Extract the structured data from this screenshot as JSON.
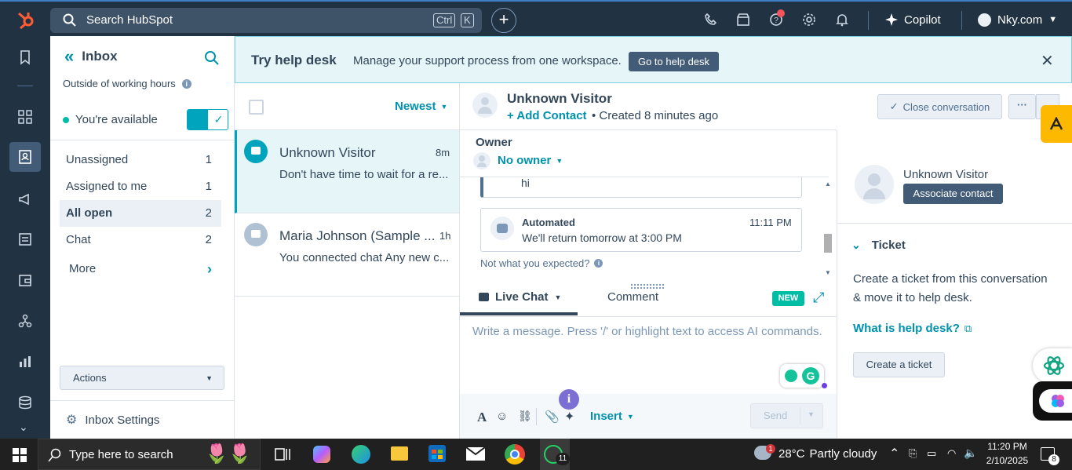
{
  "topbar": {
    "search_placeholder": "Search HubSpot",
    "shortcut_ctrl": "Ctrl",
    "shortcut_k": "K",
    "add_label": "+",
    "copilot_label": "Copilot",
    "account_name": "Nky.com"
  },
  "sidebar": {
    "title": "Inbox",
    "hours_status": "Outside of working hours",
    "availability": "You're available",
    "items": [
      {
        "label": "Unassigned",
        "count": "1"
      },
      {
        "label": "Assigned to me",
        "count": "1"
      },
      {
        "label": "All open",
        "count": "2"
      },
      {
        "label": "Chat",
        "count": "2"
      }
    ],
    "more_label": "More",
    "actions_label": "Actions",
    "settings_label": "Inbox Settings"
  },
  "banner": {
    "title": "Try help desk",
    "text": "Manage your support process from one workspace.",
    "button": "Go to help desk"
  },
  "list": {
    "sort_label": "Newest",
    "conversations": [
      {
        "name": "Unknown Visitor",
        "time": "8m",
        "preview": "Don't have time to wait for a re..."
      },
      {
        "name": "Maria Johnson (Sample ...",
        "time": "1h",
        "preview": "You connected chat Any new c..."
      }
    ]
  },
  "conversation": {
    "visitor_name": "Unknown Visitor",
    "add_contact": "+ Add Contact",
    "created": "Created 8 minutes ago",
    "close_label": "Close conversation",
    "more_label": "···",
    "owner_label": "Owner",
    "owner_value": "No owner",
    "msg_hi": "hi",
    "automated_label": "Automated",
    "automated_time": "11:11 PM",
    "automated_text": "We'll return tomorrow at 3:00 PM",
    "not_expected": "Not what you expected?",
    "tab_live_chat": "Live Chat",
    "tab_comment": "Comment",
    "new_badge": "NEW",
    "composer_placeholder": "Write a message. Press '/' or highlight text to access AI commands.",
    "insert_label": "Insert",
    "send_label": "Send",
    "info_badge": "i"
  },
  "contact_panel": {
    "name": "Unknown Visitor",
    "associate_label": "Associate contact",
    "ticket_title": "Ticket",
    "ticket_text": "Create a ticket from this conversation & move it to help desk.",
    "helpdesk_link": "What is help desk?",
    "create_ticket": "Create a ticket"
  },
  "taskbar": {
    "search_placeholder": "Type here to search",
    "whatsapp_badge": "11",
    "weather_badge": "1",
    "weather_temp": "28°C",
    "weather_text": "Partly cloudy",
    "time": "11:20 PM",
    "date": "2/10/2025",
    "notif_count": "8"
  },
  "colors": {
    "nav_dark": "#213343",
    "accent_teal": "#0091ae",
    "hubspot_orange": "#ff5c35",
    "new_badge_green": "#00bda5"
  }
}
